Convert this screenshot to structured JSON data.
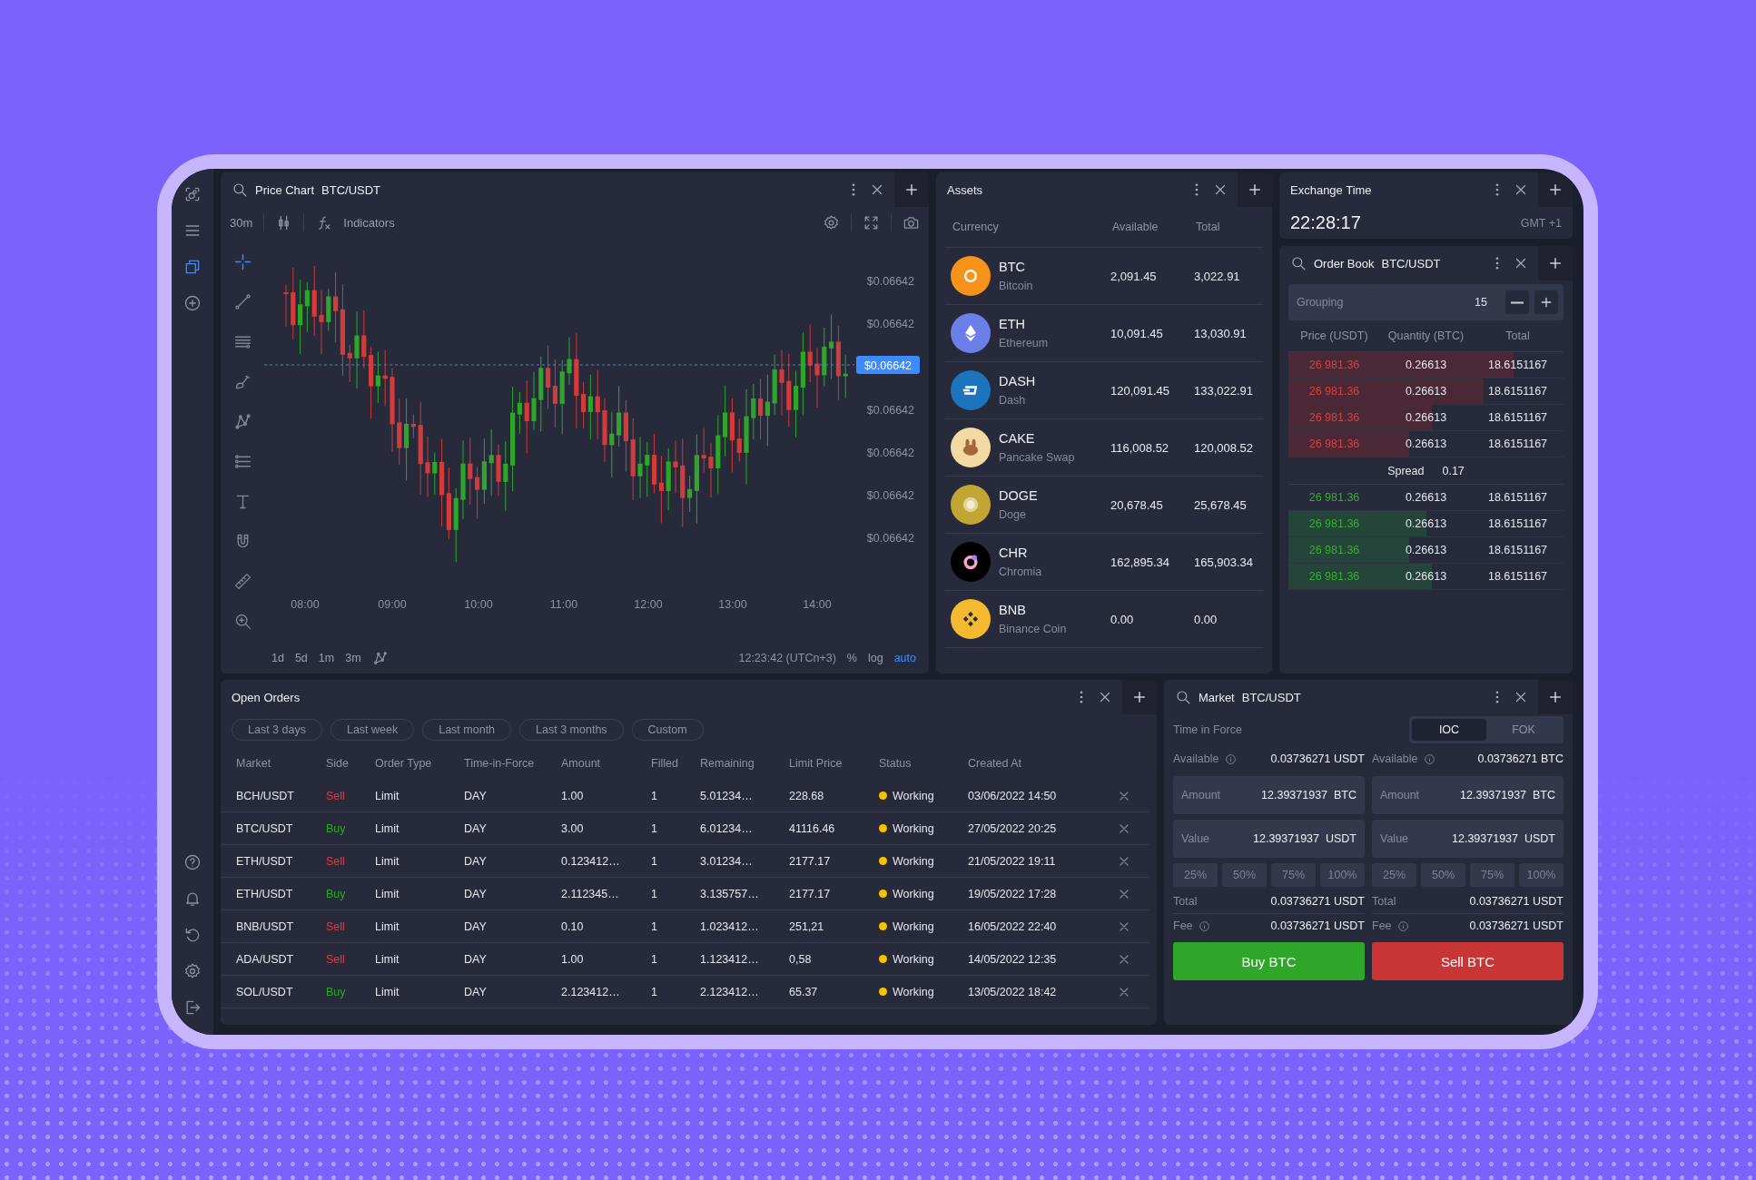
{
  "sidebar": {
    "top_items": [
      {
        "selected": false
      },
      {
        "selected": false
      },
      {
        "selected": true
      },
      {
        "selected": false
      }
    ],
    "bottom_items": [
      {
        "selected": false
      },
      {
        "selected": false
      },
      {
        "selected": false
      },
      {
        "selected": false
      },
      {
        "selected": false
      }
    ]
  },
  "price_chart": {
    "title": "Price Chart",
    "pair": "BTC/USDT",
    "interval": "30m",
    "indicators_label": "Indicators",
    "drawing_tools": [
      {
        "selected": true
      },
      {
        "selected": false
      },
      {
        "selected": false
      },
      {
        "selected": false
      },
      {
        "selected": false
      },
      {
        "selected": false
      },
      {
        "selected": false
      },
      {
        "selected": false
      },
      {
        "selected": false
      },
      {
        "selected": false
      }
    ],
    "price_labels": [
      "$0.06642",
      "$0.06642",
      "$0.06642",
      "$0.06642",
      "$0.06642",
      "$0.06642"
    ],
    "current_price": "$0.06642",
    "time_labels": [
      "08:00",
      "09:00",
      "10:00",
      "11:00",
      "12:00",
      "13:00",
      "14:00"
    ],
    "ranges": [
      "1d",
      "5d",
      "1m",
      "3m"
    ],
    "clock": "12:23:42 (UTCn+3)",
    "scale_options": [
      {
        "label": "%",
        "selected": false
      },
      {
        "label": "log",
        "selected": false
      },
      {
        "label": "auto",
        "selected": true
      }
    ]
  },
  "assets": {
    "title": "Assets",
    "columns": [
      "Currency",
      "Available",
      "Total"
    ],
    "rows": [
      {
        "symbol": "BTC",
        "name": "Bitcoin",
        "available": "2,091.45",
        "total": "3,022.91",
        "color": "#f7931a"
      },
      {
        "symbol": "ETH",
        "name": "Ethereum",
        "available": "10,091.45",
        "total": "13,030.91",
        "color": "#6c7fe8"
      },
      {
        "symbol": "DASH",
        "name": "Dash",
        "available": "120,091.45",
        "total": "133,022.91",
        "color": "#1c75bc"
      },
      {
        "symbol": "CAKE",
        "name": "Pancake Swap",
        "available": "116,008.52",
        "total": "120,008.52",
        "color": "#f3d9a4"
      },
      {
        "symbol": "DOGE",
        "name": "Doge",
        "available": "20,678.45",
        "total": "25,678.45",
        "color": "#c2a633"
      },
      {
        "symbol": "CHR",
        "name": "Chromia",
        "available": "162,895.34",
        "total": "165,903.34",
        "color": "#000000"
      },
      {
        "symbol": "BNB",
        "name": "Binance Coin",
        "available": "0.00",
        "total": "0.00",
        "color": "#f3ba2f"
      }
    ]
  },
  "exchange_time": {
    "title": "Exchange Time",
    "time": "22:28:17",
    "zone": "GMT +1"
  },
  "order_book": {
    "title": "Order Book",
    "pair": "BTC/USDT",
    "grouping_label": "Grouping",
    "grouping_value": "15",
    "columns": [
      "Price (USDT)",
      "Quantity (BTC)",
      "Total"
    ],
    "asks": [
      {
        "price": "26 981.36",
        "quantity": "0.26613",
        "total": "18.6151167",
        "level": 0.82
      },
      {
        "price": "26 981.36",
        "quantity": "0.26613",
        "total": "18.6151167",
        "level": 0.71
      },
      {
        "price": "26 981.36",
        "quantity": "0.26613",
        "total": "18.6151167",
        "level": 0.52
      },
      {
        "price": "26 981.36",
        "quantity": "0.26613",
        "total": "18.6151167",
        "level": 0.44
      }
    ],
    "spread_label": "Spread",
    "spread_value": "0.17",
    "bids": [
      {
        "price": "26 981.36",
        "quantity": "0.26613",
        "total": "18.6151167"
      },
      {
        "price": "26 981.36",
        "quantity": "0.26613",
        "total": "18.6151167",
        "level": 0.5
      },
      {
        "price": "26 981.36",
        "quantity": "0.26613",
        "total": "18.6151167",
        "level": 0.44
      },
      {
        "price": "26 981.36",
        "quantity": "0.26613",
        "total": "18.6151167",
        "level": 0.52
      }
    ]
  },
  "open_orders": {
    "title": "Open Orders",
    "filters": [
      "Last 3 days",
      "Last week",
      "Last month",
      "Last 3 months",
      "Custom"
    ],
    "columns": [
      "Market",
      "Side",
      "Order Type",
      "Time-in-Force",
      "Amount",
      "Filled",
      "Remaining",
      "Limit Price",
      "Status",
      "Created At"
    ],
    "rows": [
      {
        "market": "BCH/USDT",
        "side": "Sell",
        "color": "#d9403f",
        "order_type": "Limit",
        "time_in_force": "DAY",
        "amount": "1.00",
        "filled": "1",
        "remaining": "5.01234…",
        "limit_price": "228.68",
        "status": "Working",
        "created_at": "03/06/2022 14:50"
      },
      {
        "market": "BTC/USDT",
        "side": "Buy",
        "color": "#2fa52a",
        "order_type": "Limit",
        "time_in_force": "DAY",
        "amount": "3.00",
        "filled": "1",
        "remaining": "6.01234…",
        "limit_price": "41116.46",
        "status": "Working",
        "created_at": "27/05/2022 20:25"
      },
      {
        "market": "ETH/USDT",
        "side": "Sell",
        "color": "#d9403f",
        "order_type": "Limit",
        "time_in_force": "DAY",
        "amount": "0.123412…",
        "filled": "1",
        "remaining": "3.01234…",
        "limit_price": "2177.17",
        "status": "Working",
        "created_at": "21/05/2022 19:11"
      },
      {
        "market": "ETH/USDT",
        "side": "Buy",
        "color": "#2fa52a",
        "order_type": "Limit",
        "time_in_force": "DAY",
        "amount": "2.112345…",
        "filled": "1",
        "remaining": "3.135757…",
        "limit_price": "2177.17",
        "status": "Working",
        "created_at": "19/05/2022 17:28"
      },
      {
        "market": "BNB/USDT",
        "side": "Sell",
        "color": "#d9403f",
        "order_type": "Limit",
        "time_in_force": "DAY",
        "amount": "0.10",
        "filled": "1",
        "remaining": "1.023412…",
        "limit_price": "251,21",
        "status": "Working",
        "created_at": "16/05/2022 22:40"
      },
      {
        "market": "ADA/USDT",
        "side": "Sell",
        "color": "#d9403f",
        "order_type": "Limit",
        "time_in_force": "DAY",
        "amount": "1.00",
        "filled": "1",
        "remaining": "1.123412…",
        "limit_price": "0,58",
        "status": "Working",
        "created_at": "14/05/2022 12:35"
      },
      {
        "market": "SOL/USDT",
        "side": "Buy",
        "color": "#2fa52a",
        "order_type": "Limit",
        "time_in_force": "DAY",
        "amount": "2.123412…",
        "filled": "1",
        "remaining": "2.123412…",
        "limit_price": "65.37",
        "status": "Working",
        "created_at": "13/05/2022 18:42"
      }
    ]
  },
  "market": {
    "title": "Market",
    "pair": "BTC/USDT",
    "time_in_force_label": "Time in Force",
    "time_in_force_options": [
      {
        "label": "IOC",
        "selected": true
      },
      {
        "label": "FOK",
        "selected": false
      }
    ],
    "sides": [
      {
        "kind": "buy",
        "available_label": "Available",
        "available": "0.03736271 USDT",
        "amount_label": "Amount",
        "amount": "12.39371937",
        "amount_unit": "BTC",
        "value_label": "Value",
        "value": "12.39371937",
        "value_unit": "USDT",
        "percentages": [
          "25%",
          "50%",
          "75%",
          "100%"
        ],
        "total_label": "Total",
        "total": "0.03736271 USDT",
        "fee_label": "Fee",
        "fee": "0.03736271 USDT",
        "button": "Buy BTC"
      },
      {
        "kind": "sell",
        "available_label": "Available",
        "available": "0.03736271 BTC",
        "amount_label": "Amount",
        "amount": "12.39371937",
        "amount_unit": "BTC",
        "value_label": "Value",
        "value": "12.39371937",
        "value_unit": "USDT",
        "percentages": [
          "25%",
          "50%",
          "75%",
          "100%"
        ],
        "total_label": "Total",
        "total": "0.03736271 USDT",
        "fee_label": "Fee",
        "fee": "0.03736271 USDT",
        "button": "Sell BTC"
      }
    ]
  }
}
